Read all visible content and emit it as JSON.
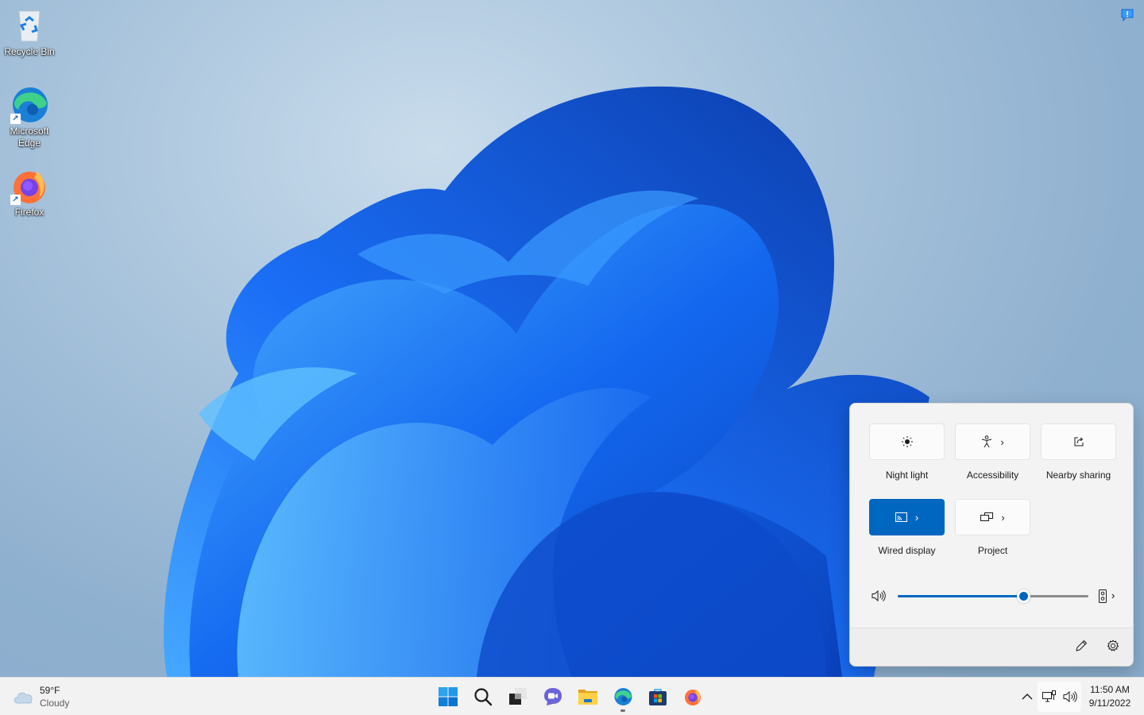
{
  "desktop": {
    "icons": [
      {
        "label": "Recycle Bin",
        "icon": "recycle-bin-icon"
      },
      {
        "label": "Microsoft Edge",
        "icon": "edge-icon",
        "shortcut": true
      },
      {
        "label": "Firefox",
        "icon": "firefox-icon",
        "shortcut": true
      }
    ],
    "notification_icon": "feedback-notification-icon"
  },
  "quick_settings": {
    "tiles": [
      {
        "label": "Night light",
        "icon": "night-light-icon",
        "active": false,
        "has_chevron": false
      },
      {
        "label": "Accessibility",
        "icon": "accessibility-icon",
        "active": false,
        "has_chevron": true
      },
      {
        "label": "Nearby sharing",
        "icon": "nearby-sharing-icon",
        "active": false,
        "has_chevron": false
      },
      {
        "label": "Wired display",
        "icon": "cast-icon",
        "active": true,
        "has_chevron": true
      },
      {
        "label": "Project",
        "icon": "project-icon",
        "active": false,
        "has_chevron": true
      }
    ],
    "chevron": "›",
    "volume": {
      "percent": 66,
      "icon": "speaker-icon",
      "output_icon": "speaker-device-icon"
    },
    "footer": {
      "edit_icon": "pencil-icon",
      "settings_icon": "gear-icon"
    },
    "accent_color": "#0067c0"
  },
  "taskbar": {
    "weather": {
      "temp": "59°F",
      "condition": "Cloudy",
      "icon": "cloud-icon"
    },
    "apps": [
      {
        "name": "Start",
        "icon": "windows-start-icon"
      },
      {
        "name": "Search",
        "icon": "search-icon"
      },
      {
        "name": "Task View",
        "icon": "task-view-icon"
      },
      {
        "name": "Chat",
        "icon": "teams-chat-icon"
      },
      {
        "name": "File Explorer",
        "icon": "folder-icon"
      },
      {
        "name": "Microsoft Edge",
        "icon": "edge-icon",
        "running": true
      },
      {
        "name": "Microsoft Store",
        "icon": "store-icon"
      },
      {
        "name": "Firefox",
        "icon": "firefox-icon"
      }
    ],
    "tray": {
      "overflow_icon": "chevron-up-icon",
      "network_icon": "ethernet-icon",
      "volume_icon": "speaker-icon"
    },
    "clock": {
      "time": "11:50 AM",
      "date": "9/11/2022"
    }
  }
}
